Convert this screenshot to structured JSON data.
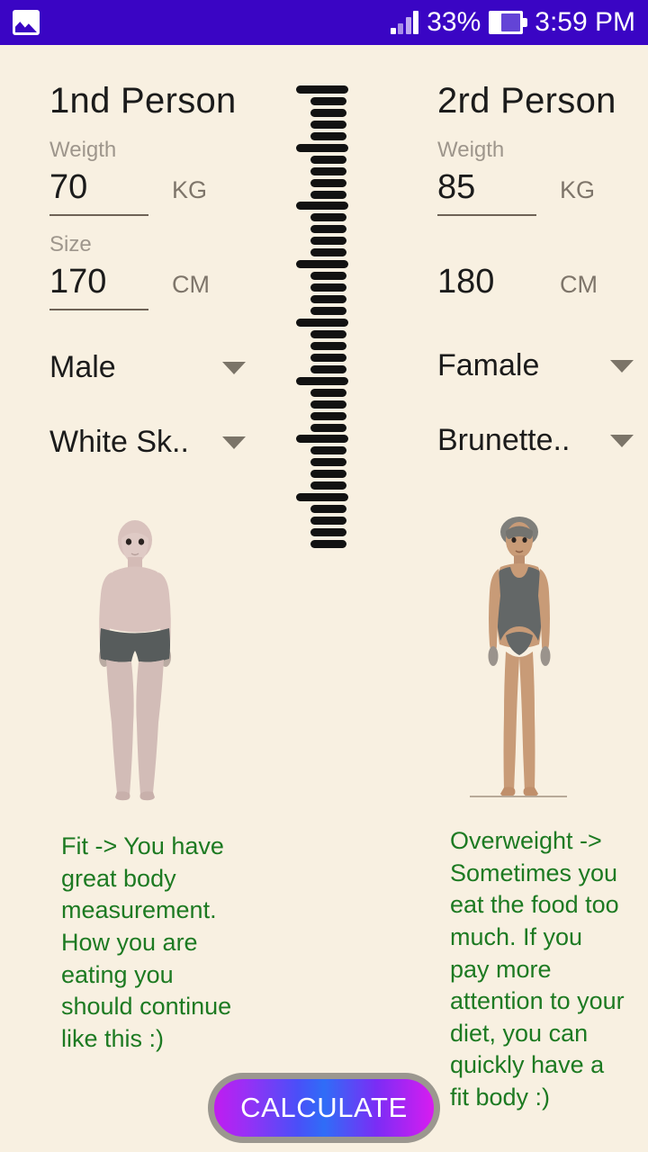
{
  "status_bar": {
    "app_icon": "photo-icon",
    "signal_icon": "signal-bars-icon",
    "battery_percent": "33%",
    "battery_icon": "battery-icon",
    "time": "3:59 PM",
    "background_color": "#3a05c4"
  },
  "theme": {
    "page_background": "#f8f0e1",
    "result_text_color": "#1d7a22",
    "label_color": "#9e968c",
    "underline_color": "#6e6256"
  },
  "person_left": {
    "title": "1nd Person",
    "weight_label": "Weigth",
    "weight_value": "70",
    "weight_unit": "KG",
    "size_label": "Size",
    "size_value": "170",
    "size_unit": "CM",
    "gender": "Male",
    "skin": "White Sk..",
    "result": "Fit -> You have great body measurement. How you are eating you should continue like this :)",
    "figure": "male-body-figure"
  },
  "person_right": {
    "title": "2rd Person",
    "weight_label": "Weigth",
    "weight_value": "85",
    "weight_unit": "KG",
    "size_label": "",
    "size_value": "180",
    "size_unit": "CM",
    "gender": "Famale",
    "skin": "Brunette..",
    "result": "Overweight -> Sometimes you eat the food too much. If you pay more attention to your diet, you can quickly have a fit body :)",
    "figure": "female-body-figure"
  },
  "divider": {
    "name": "ruler-divider",
    "tick_count": 40,
    "major_every": 5
  },
  "action": {
    "calculate_label": "CALCULATE"
  }
}
